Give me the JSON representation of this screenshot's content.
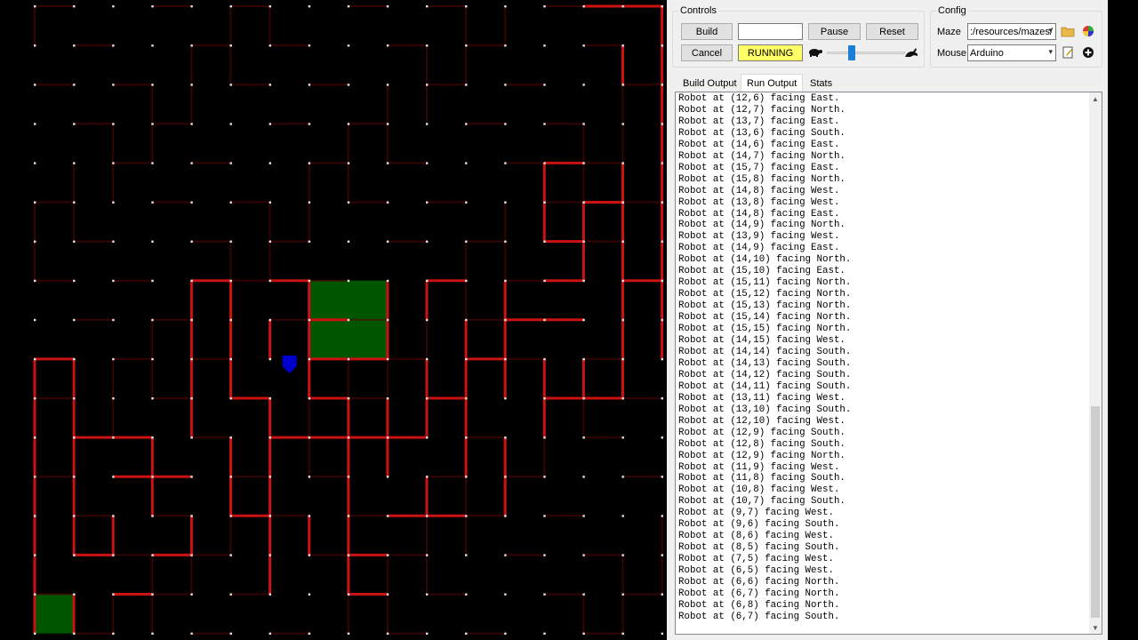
{
  "maze": {
    "background": "#000000",
    "wall_color": "#cc1111",
    "goal_color": "#005500",
    "start_color": "#005500",
    "robot_color": "#0000cc"
  },
  "controls": {
    "legend": "Controls",
    "build_label": "Build",
    "cancel_label": "Cancel",
    "pause_label": "Pause",
    "reset_label": "Reset",
    "blank_field": "",
    "status": "RUNNING",
    "status_color": "#ffff66"
  },
  "config": {
    "legend": "Config",
    "maze_label": "Maze",
    "maze_value": ":/resources/mazes/",
    "mouse_label": "Mouse",
    "mouse_value": "Arduino"
  },
  "tabs": [
    {
      "label": "Build Output"
    },
    {
      "label": "Run Output"
    },
    {
      "label": "Stats"
    }
  ],
  "output_lines": [
    "Robot at (12,6) facing East.",
    "Robot at (12,7) facing North.",
    "Robot at (13,7) facing East.",
    "Robot at (13,6) facing South.",
    "Robot at (14,6) facing East.",
    "Robot at (14,7) facing North.",
    "Robot at (15,7) facing East.",
    "Robot at (15,8) facing North.",
    "Robot at (14,8) facing West.",
    "Robot at (13,8) facing West.",
    "Robot at (14,8) facing East.",
    "Robot at (14,9) facing North.",
    "Robot at (13,9) facing West.",
    "Robot at (14,9) facing East.",
    "Robot at (14,10) facing North.",
    "Robot at (15,10) facing East.",
    "Robot at (15,11) facing North.",
    "Robot at (15,12) facing North.",
    "Robot at (15,13) facing North.",
    "Robot at (15,14) facing North.",
    "Robot at (15,15) facing North.",
    "Robot at (14,15) facing West.",
    "Robot at (14,14) facing South.",
    "Robot at (14,13) facing South.",
    "Robot at (14,12) facing South.",
    "Robot at (14,11) facing South.",
    "Robot at (13,11) facing West.",
    "Robot at (13,10) facing South.",
    "Robot at (12,10) facing West.",
    "Robot at (12,9) facing South.",
    "Robot at (12,8) facing South.",
    "Robot at (12,9) facing North.",
    "Robot at (11,9) facing West.",
    "Robot at (11,8) facing South.",
    "Robot at (10,8) facing West.",
    "Robot at (10,7) facing South.",
    "Robot at (9,7) facing West.",
    "Robot at (9,6) facing South.",
    "Robot at (8,6) facing West.",
    "Robot at (8,5) facing South.",
    "Robot at (7,5) facing West.",
    "Robot at (6,5) facing West.",
    "Robot at (6,6) facing North.",
    "Robot at (6,7) facing North.",
    "Robot at (6,8) facing North.",
    "Robot at (6,7) facing South."
  ],
  "icons": {
    "slow": "turtle-icon",
    "fast": "rabbit-icon",
    "folder": "folder-icon",
    "color": "color-wheel-icon",
    "edit": "edit-icon",
    "add": "add-icon"
  }
}
